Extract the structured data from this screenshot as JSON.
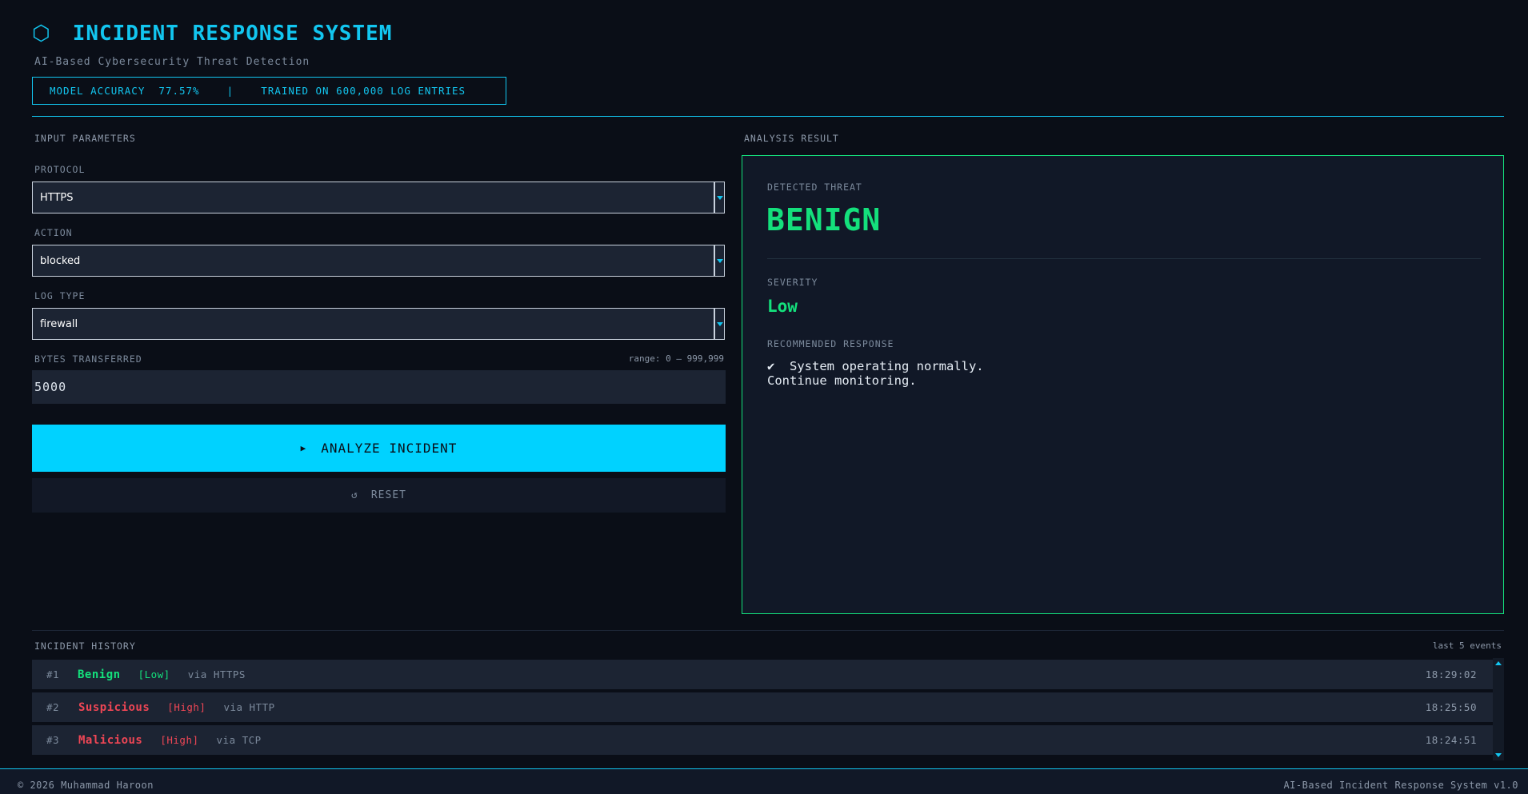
{
  "header": {
    "icon": "hexagon-icon",
    "title": "INCIDENT RESPONSE SYSTEM",
    "subtitle": "AI-Based Cybersecurity Threat Detection",
    "stats": "MODEL ACCURACY  77.57%    |    TRAINED ON 600,000 LOG ENTRIES"
  },
  "input": {
    "section_label": "INPUT PARAMETERS",
    "protocol": {
      "label": "PROTOCOL",
      "value": "HTTPS"
    },
    "action": {
      "label": "ACTION",
      "value": "blocked"
    },
    "log_type": {
      "label": "LOG TYPE",
      "value": "firewall"
    },
    "bytes": {
      "label": "BYTES TRANSFERRED",
      "range_hint": "range: 0 – 999,999",
      "value": "5000"
    },
    "analyze_icon": "▶",
    "analyze_label": "ANALYZE INCIDENT",
    "reset_icon": "↺",
    "reset_label": "RESET"
  },
  "result": {
    "section_label": "ANALYSIS RESULT",
    "detected_label": "DETECTED THREAT",
    "threat": "BENIGN",
    "severity_label": "SEVERITY",
    "severity": "Low",
    "response_label": "RECOMMENDED RESPONSE",
    "response": "✔  System operating normally.\nContinue monitoring.",
    "accent_color": "#14e07c"
  },
  "history": {
    "label": "INCIDENT HISTORY",
    "count": "last 5 events",
    "rows": [
      {
        "num": "#1",
        "class": "Benign",
        "severity": "[Low]",
        "via": "via HTTPS",
        "time": "18:29:02",
        "color": "#14e07c"
      },
      {
        "num": "#2",
        "class": "Suspicious",
        "severity": "[High]",
        "via": "via HTTP",
        "time": "18:25:50",
        "color": "#ef4655"
      },
      {
        "num": "#3",
        "class": "Malicious",
        "severity": "[High]",
        "via": "via TCP",
        "time": "18:24:51",
        "color": "#ef4655"
      }
    ]
  },
  "footer": {
    "left": "© 2026 Muhammad Haroon",
    "right": "AI-Based Incident Response System  v1.0"
  }
}
